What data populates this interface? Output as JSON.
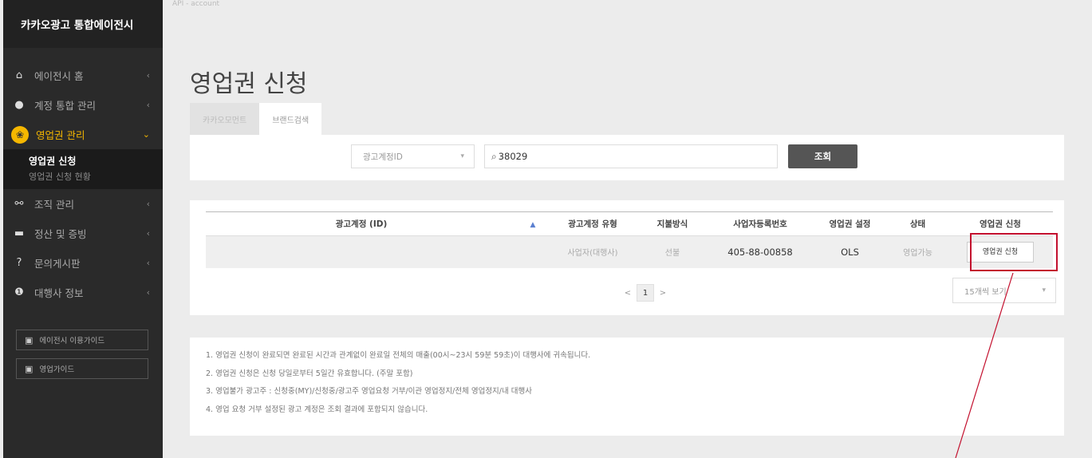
{
  "sidebar": {
    "brand": "카카오광고 통합에이전시",
    "items": [
      {
        "label": "에이전시 홈",
        "icon": "home-icon",
        "glyph": "⌂"
      },
      {
        "label": "계정 통합 관리",
        "icon": "user-icon",
        "glyph": "●"
      },
      {
        "label": "영업권 관리",
        "icon": "group-icon",
        "glyph": "❀",
        "active": true
      },
      {
        "label": "조직 관리",
        "icon": "org-chart-icon",
        "glyph": "⚯"
      },
      {
        "label": "정산 및 증빙",
        "icon": "briefcase-icon",
        "glyph": "▬"
      },
      {
        "label": "문의게시판",
        "icon": "question-icon",
        "glyph": "?"
      },
      {
        "label": "대행사 정보",
        "icon": "info-icon",
        "glyph": "❶"
      }
    ],
    "submenu": [
      "영업권 신청",
      "영업권 신청 현황"
    ],
    "guides": [
      "에이전시 이용가이드",
      "영업가이드"
    ]
  },
  "breadcrumb": "API - account",
  "page_title": "영업권 신청",
  "tabs": [
    "카카오모먼트",
    "브랜드검색"
  ],
  "search": {
    "select_value": "광고계정ID",
    "query": "38029",
    "button_label": "조회"
  },
  "table": {
    "headers": [
      "광고계정 (ID)",
      "광고계정 유형",
      "지불방식",
      "사업자등록번호",
      "영업권 설정",
      "상태",
      "영업권 신청"
    ],
    "rows": [
      {
        "account": "",
        "type": "사업자(대행사)",
        "payment": "선불",
        "biz_no": "405-88-00858",
        "setting": "OLS",
        "status": "영업가능",
        "action": "영업권 신청"
      }
    ]
  },
  "pagination": {
    "prev": "<",
    "current": "1",
    "next": ">"
  },
  "per_page": "15개씩 보기",
  "notes": [
    "1. 영업권 신청이 완료되면 완료된 시간과 관계없이 완료일 전체의 매출(00시~23시 59분 59초)이 대행사에 귀속됩니다.",
    "2. 영업권 신청은 신청 당일로부터 5일간 유효합니다. (주말 포함)",
    "3. 영업불가 광고주 : 신청중(MY)/신청중/광고주 영업요청 거부/이관 영업정지/전체 영업정지/내 대행사",
    "4. 영업 요청 거부 설정된 광고 계정은 조회 결과에 포함되지 않습니다."
  ],
  "colors": {
    "accent": "#f5b700",
    "highlight": "#c3102e",
    "sidebar": "#2a2a2a"
  }
}
